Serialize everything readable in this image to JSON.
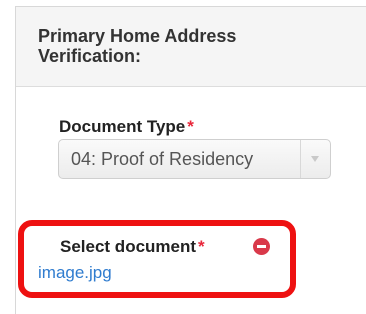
{
  "panel": {
    "title": "Primary Home Address Verification:"
  },
  "document_type": {
    "label": "Document Type",
    "required_marker": "*",
    "selected_value": "04: Proof of Residency"
  },
  "select_document": {
    "label": "Select document",
    "required_marker": "*",
    "file_name": "image.jpg",
    "remove_icon": "minus-circle-icon"
  },
  "colors": {
    "required": "#e8273a",
    "link": "#2f7ccf",
    "highlight": "#ee1111",
    "remove": "#d9394a"
  }
}
